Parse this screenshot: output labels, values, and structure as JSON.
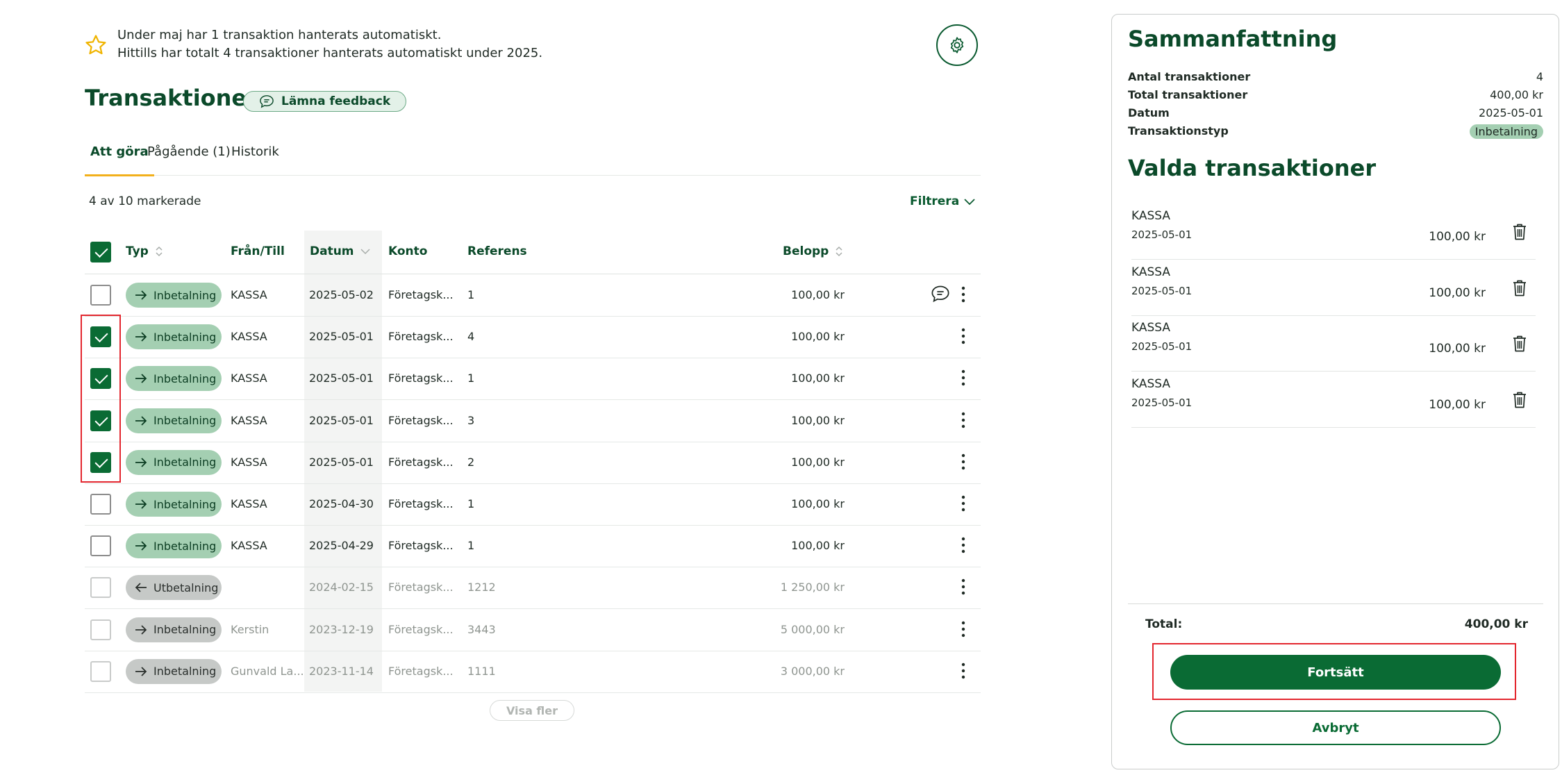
{
  "banner": {
    "line1": "Under maj har 1 transaktion hanterats automatiskt.",
    "line2": "Hittills har totalt 4 transaktioner hanterats automatiskt under 2025."
  },
  "header": {
    "title": "Transaktioner",
    "feedback_label": "Lämna feedback"
  },
  "tabs": [
    {
      "label": "Att göra",
      "active": true
    },
    {
      "label": "Pågående (1)",
      "active": false
    },
    {
      "label": "Historik",
      "active": false
    }
  ],
  "selection_text": "4 av 10 markerade",
  "filter_label": "Filtrera",
  "columns": {
    "typ": "Typ",
    "fran_till": "Från/Till",
    "datum": "Datum",
    "konto": "Konto",
    "referens": "Referens",
    "belopp": "Belopp"
  },
  "rows": [
    {
      "checked": false,
      "type": "Inbetalning",
      "from_to": "KASSA",
      "date": "2025-05-02",
      "account": "Företagsk...",
      "ref": "1",
      "amount": "100,00 kr",
      "muted": false,
      "comment": true
    },
    {
      "checked": true,
      "type": "Inbetalning",
      "from_to": "KASSA",
      "date": "2025-05-01",
      "account": "Företagsk...",
      "ref": "4",
      "amount": "100,00 kr",
      "muted": false
    },
    {
      "checked": true,
      "type": "Inbetalning",
      "from_to": "KASSA",
      "date": "2025-05-01",
      "account": "Företagsk...",
      "ref": "1",
      "amount": "100,00 kr",
      "muted": false
    },
    {
      "checked": true,
      "type": "Inbetalning",
      "from_to": "KASSA",
      "date": "2025-05-01",
      "account": "Företagsk...",
      "ref": "3",
      "amount": "100,00 kr",
      "muted": false
    },
    {
      "checked": true,
      "type": "Inbetalning",
      "from_to": "KASSA",
      "date": "2025-05-01",
      "account": "Företagsk...",
      "ref": "2",
      "amount": "100,00 kr",
      "muted": false
    },
    {
      "checked": false,
      "type": "Inbetalning",
      "from_to": "KASSA",
      "date": "2025-04-30",
      "account": "Företagsk...",
      "ref": "1",
      "amount": "100,00 kr",
      "muted": false
    },
    {
      "checked": false,
      "type": "Inbetalning",
      "from_to": "KASSA",
      "date": "2025-04-29",
      "account": "Företagsk...",
      "ref": "1",
      "amount": "100,00 kr",
      "muted": false
    },
    {
      "checked": false,
      "type": "Utbetalning",
      "from_to": "",
      "date": "2024-02-15",
      "account": "Företagsk...",
      "ref": "1212",
      "amount": "1 250,00 kr",
      "muted": true,
      "direction": "out"
    },
    {
      "checked": false,
      "type": "Inbetalning",
      "from_to": "Kerstin",
      "date": "2023-12-19",
      "account": "Företagsk...",
      "ref": "3443",
      "amount": "5 000,00 kr",
      "muted": true
    },
    {
      "checked": false,
      "type": "Inbetalning",
      "from_to": "Gunvald La...",
      "date": "2023-11-14",
      "account": "Företagsk...",
      "ref": "1111",
      "amount": "3 000,00 kr",
      "muted": true
    }
  ],
  "show_more_label": "Visa fler",
  "summary": {
    "title": "Sammanfattning",
    "rows": [
      {
        "label": "Antal transaktioner",
        "value": "4"
      },
      {
        "label": "Total transaktioner",
        "value": "400,00 kr"
      },
      {
        "label": "Datum",
        "value": "2025-05-01"
      },
      {
        "label": "Transaktionstyp",
        "value": "Inbetalning"
      }
    ],
    "selected_title": "Valda transaktioner",
    "selected": [
      {
        "name": "KASSA",
        "date": "2025-05-01",
        "amount": "100,00 kr"
      },
      {
        "name": "KASSA",
        "date": "2025-05-01",
        "amount": "100,00 kr"
      },
      {
        "name": "KASSA",
        "date": "2025-05-01",
        "amount": "100,00 kr"
      },
      {
        "name": "KASSA",
        "date": "2025-05-01",
        "amount": "100,00 kr"
      }
    ],
    "total_label": "Total:",
    "total_value": "400,00 kr",
    "continue_label": "Fortsätt",
    "cancel_label": "Avbryt"
  },
  "colors": {
    "primary": "#0a6b34",
    "accent_tab": "#f2b01c",
    "pill_in": "#a4cfb2",
    "pill_muted": "#c6c9c7",
    "highlight_box": "#e3262e"
  },
  "icons": [
    "star-icon",
    "gear-icon",
    "comment-icon",
    "arrow-right-icon",
    "arrow-left-icon",
    "kebab-icon",
    "trash-icon",
    "sort-icon",
    "chevron-down-icon"
  ]
}
